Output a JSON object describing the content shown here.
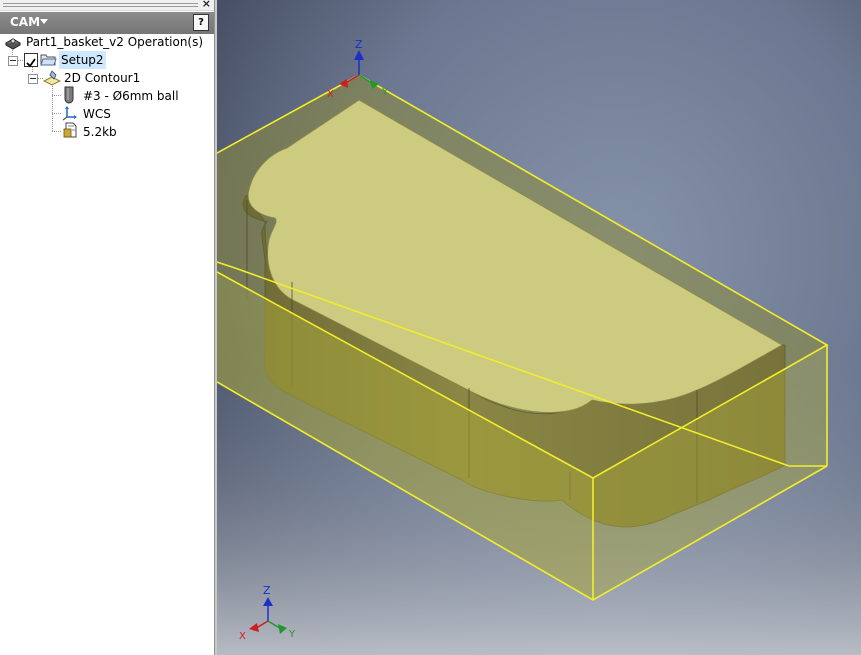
{
  "browser": {
    "close_glyph": "×",
    "header_title": "CAM",
    "help_glyph": "?",
    "tree": {
      "root_label": "Part1_basket_v2 Operation(s)",
      "setup_label": "Setup2",
      "operation_label": "2D Contour1",
      "tool_label": "#3 - Ø6mm ball",
      "wcs_label": "WCS",
      "file_label": "5.2kb"
    }
  },
  "viewport": {
    "axis_labels": {
      "x": "X",
      "y": "Y",
      "z": "Z"
    },
    "colors": {
      "stock_outline": "#f3ee2a",
      "part_top": "#cccb80",
      "stock_fill": "#a8a63a",
      "axis_x": "#cc1f1f",
      "axis_y": "#1e9a2a",
      "axis_z": "#1c2fc7"
    }
  }
}
